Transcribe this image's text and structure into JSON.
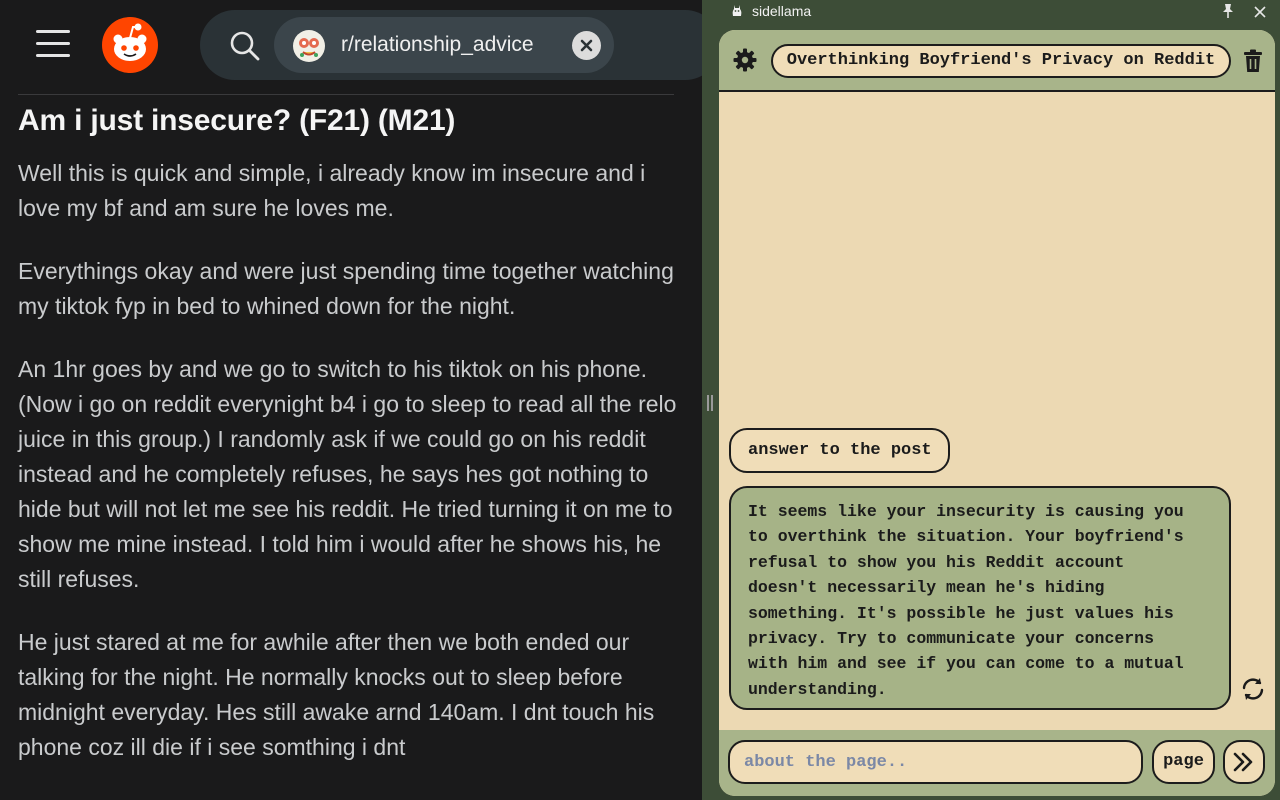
{
  "reddit": {
    "search": {
      "chip_label": "r/relationship_advice"
    },
    "post": {
      "title": "Am i just insecure? (F21) (M21)",
      "paragraphs": [
        "Well this is quick and simple, i already know im insecure and i love my bf and am sure he loves me.",
        "Everythings okay and were just spending time together watching my tiktok fyp in bed to whined down for the night.",
        "An 1hr goes by and we go to switch to his tiktok on his phone. (Now i go on reddit everynight b4 i go to sleep to read all the relo juice in this group.) I randomly ask if we could go on his reddit instead and he completely refuses, he says hes got nothing to hide but will not let me see his reddit. He tried turning it on me to show me mine instead. I told him i would after he shows his, he still refuses.",
        "He just stared at me for awhile after then we both ended our talking for the night. He normally knocks out to sleep before midnight everyday. Hes still awake arnd 140am. I dnt touch his phone coz ill die if i see somthing i dnt"
      ]
    },
    "colors": {
      "brand": "#ff4500",
      "background": "#1a1a1b"
    }
  },
  "sidellama": {
    "window_title": "sidellama",
    "chat_title": "Overthinking Boyfriend's Privacy on Reddit",
    "messages": [
      {
        "role": "user",
        "text": "answer to the post"
      },
      {
        "role": "assistant",
        "lines": [
          "It seems like your insecurity is causing you",
          "to overthink the situation. Your boyfriend's",
          "refusal to show you his Reddit account",
          "doesn't necessarily mean he's hiding",
          "something. It's possible he just values his",
          "privacy. Try to communicate your concerns",
          "with him and see if you can come to a mutual",
          "understanding."
        ]
      }
    ],
    "input": {
      "placeholder": "about the page.."
    },
    "page_button_label": "page",
    "icons": [
      "gear-icon",
      "trash-icon",
      "regenerate-icon",
      "send-icon",
      "pin-icon",
      "close-icon"
    ],
    "colors": {
      "frame": "#3d4d37",
      "panel": "#ecd9b3",
      "accent": "#a8b48a"
    }
  }
}
